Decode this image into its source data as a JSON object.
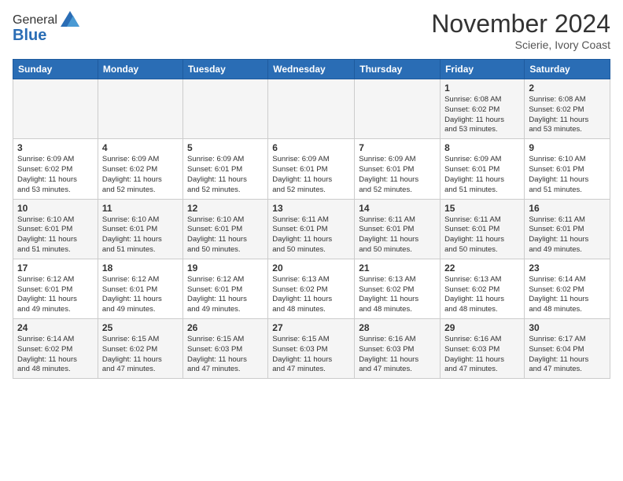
{
  "logo": {
    "general": "General",
    "blue": "Blue"
  },
  "title": "November 2024",
  "location": "Scierie, Ivory Coast",
  "days_of_week": [
    "Sunday",
    "Monday",
    "Tuesday",
    "Wednesday",
    "Thursday",
    "Friday",
    "Saturday"
  ],
  "weeks": [
    [
      {
        "day": "",
        "info": ""
      },
      {
        "day": "",
        "info": ""
      },
      {
        "day": "",
        "info": ""
      },
      {
        "day": "",
        "info": ""
      },
      {
        "day": "",
        "info": ""
      },
      {
        "day": "1",
        "info": "Sunrise: 6:08 AM\nSunset: 6:02 PM\nDaylight: 11 hours\nand 53 minutes."
      },
      {
        "day": "2",
        "info": "Sunrise: 6:08 AM\nSunset: 6:02 PM\nDaylight: 11 hours\nand 53 minutes."
      }
    ],
    [
      {
        "day": "3",
        "info": "Sunrise: 6:09 AM\nSunset: 6:02 PM\nDaylight: 11 hours\nand 53 minutes."
      },
      {
        "day": "4",
        "info": "Sunrise: 6:09 AM\nSunset: 6:02 PM\nDaylight: 11 hours\nand 52 minutes."
      },
      {
        "day": "5",
        "info": "Sunrise: 6:09 AM\nSunset: 6:01 PM\nDaylight: 11 hours\nand 52 minutes."
      },
      {
        "day": "6",
        "info": "Sunrise: 6:09 AM\nSunset: 6:01 PM\nDaylight: 11 hours\nand 52 minutes."
      },
      {
        "day": "7",
        "info": "Sunrise: 6:09 AM\nSunset: 6:01 PM\nDaylight: 11 hours\nand 52 minutes."
      },
      {
        "day": "8",
        "info": "Sunrise: 6:09 AM\nSunset: 6:01 PM\nDaylight: 11 hours\nand 51 minutes."
      },
      {
        "day": "9",
        "info": "Sunrise: 6:10 AM\nSunset: 6:01 PM\nDaylight: 11 hours\nand 51 minutes."
      }
    ],
    [
      {
        "day": "10",
        "info": "Sunrise: 6:10 AM\nSunset: 6:01 PM\nDaylight: 11 hours\nand 51 minutes."
      },
      {
        "day": "11",
        "info": "Sunrise: 6:10 AM\nSunset: 6:01 PM\nDaylight: 11 hours\nand 51 minutes."
      },
      {
        "day": "12",
        "info": "Sunrise: 6:10 AM\nSunset: 6:01 PM\nDaylight: 11 hours\nand 50 minutes."
      },
      {
        "day": "13",
        "info": "Sunrise: 6:11 AM\nSunset: 6:01 PM\nDaylight: 11 hours\nand 50 minutes."
      },
      {
        "day": "14",
        "info": "Sunrise: 6:11 AM\nSunset: 6:01 PM\nDaylight: 11 hours\nand 50 minutes."
      },
      {
        "day": "15",
        "info": "Sunrise: 6:11 AM\nSunset: 6:01 PM\nDaylight: 11 hours\nand 50 minutes."
      },
      {
        "day": "16",
        "info": "Sunrise: 6:11 AM\nSunset: 6:01 PM\nDaylight: 11 hours\nand 49 minutes."
      }
    ],
    [
      {
        "day": "17",
        "info": "Sunrise: 6:12 AM\nSunset: 6:01 PM\nDaylight: 11 hours\nand 49 minutes."
      },
      {
        "day": "18",
        "info": "Sunrise: 6:12 AM\nSunset: 6:01 PM\nDaylight: 11 hours\nand 49 minutes."
      },
      {
        "day": "19",
        "info": "Sunrise: 6:12 AM\nSunset: 6:01 PM\nDaylight: 11 hours\nand 49 minutes."
      },
      {
        "day": "20",
        "info": "Sunrise: 6:13 AM\nSunset: 6:02 PM\nDaylight: 11 hours\nand 48 minutes."
      },
      {
        "day": "21",
        "info": "Sunrise: 6:13 AM\nSunset: 6:02 PM\nDaylight: 11 hours\nand 48 minutes."
      },
      {
        "day": "22",
        "info": "Sunrise: 6:13 AM\nSunset: 6:02 PM\nDaylight: 11 hours\nand 48 minutes."
      },
      {
        "day": "23",
        "info": "Sunrise: 6:14 AM\nSunset: 6:02 PM\nDaylight: 11 hours\nand 48 minutes."
      }
    ],
    [
      {
        "day": "24",
        "info": "Sunrise: 6:14 AM\nSunset: 6:02 PM\nDaylight: 11 hours\nand 48 minutes."
      },
      {
        "day": "25",
        "info": "Sunrise: 6:15 AM\nSunset: 6:02 PM\nDaylight: 11 hours\nand 47 minutes."
      },
      {
        "day": "26",
        "info": "Sunrise: 6:15 AM\nSunset: 6:03 PM\nDaylight: 11 hours\nand 47 minutes."
      },
      {
        "day": "27",
        "info": "Sunrise: 6:15 AM\nSunset: 6:03 PM\nDaylight: 11 hours\nand 47 minutes."
      },
      {
        "day": "28",
        "info": "Sunrise: 6:16 AM\nSunset: 6:03 PM\nDaylight: 11 hours\nand 47 minutes."
      },
      {
        "day": "29",
        "info": "Sunrise: 6:16 AM\nSunset: 6:03 PM\nDaylight: 11 hours\nand 47 minutes."
      },
      {
        "day": "30",
        "info": "Sunrise: 6:17 AM\nSunset: 6:04 PM\nDaylight: 11 hours\nand 47 minutes."
      }
    ]
  ]
}
